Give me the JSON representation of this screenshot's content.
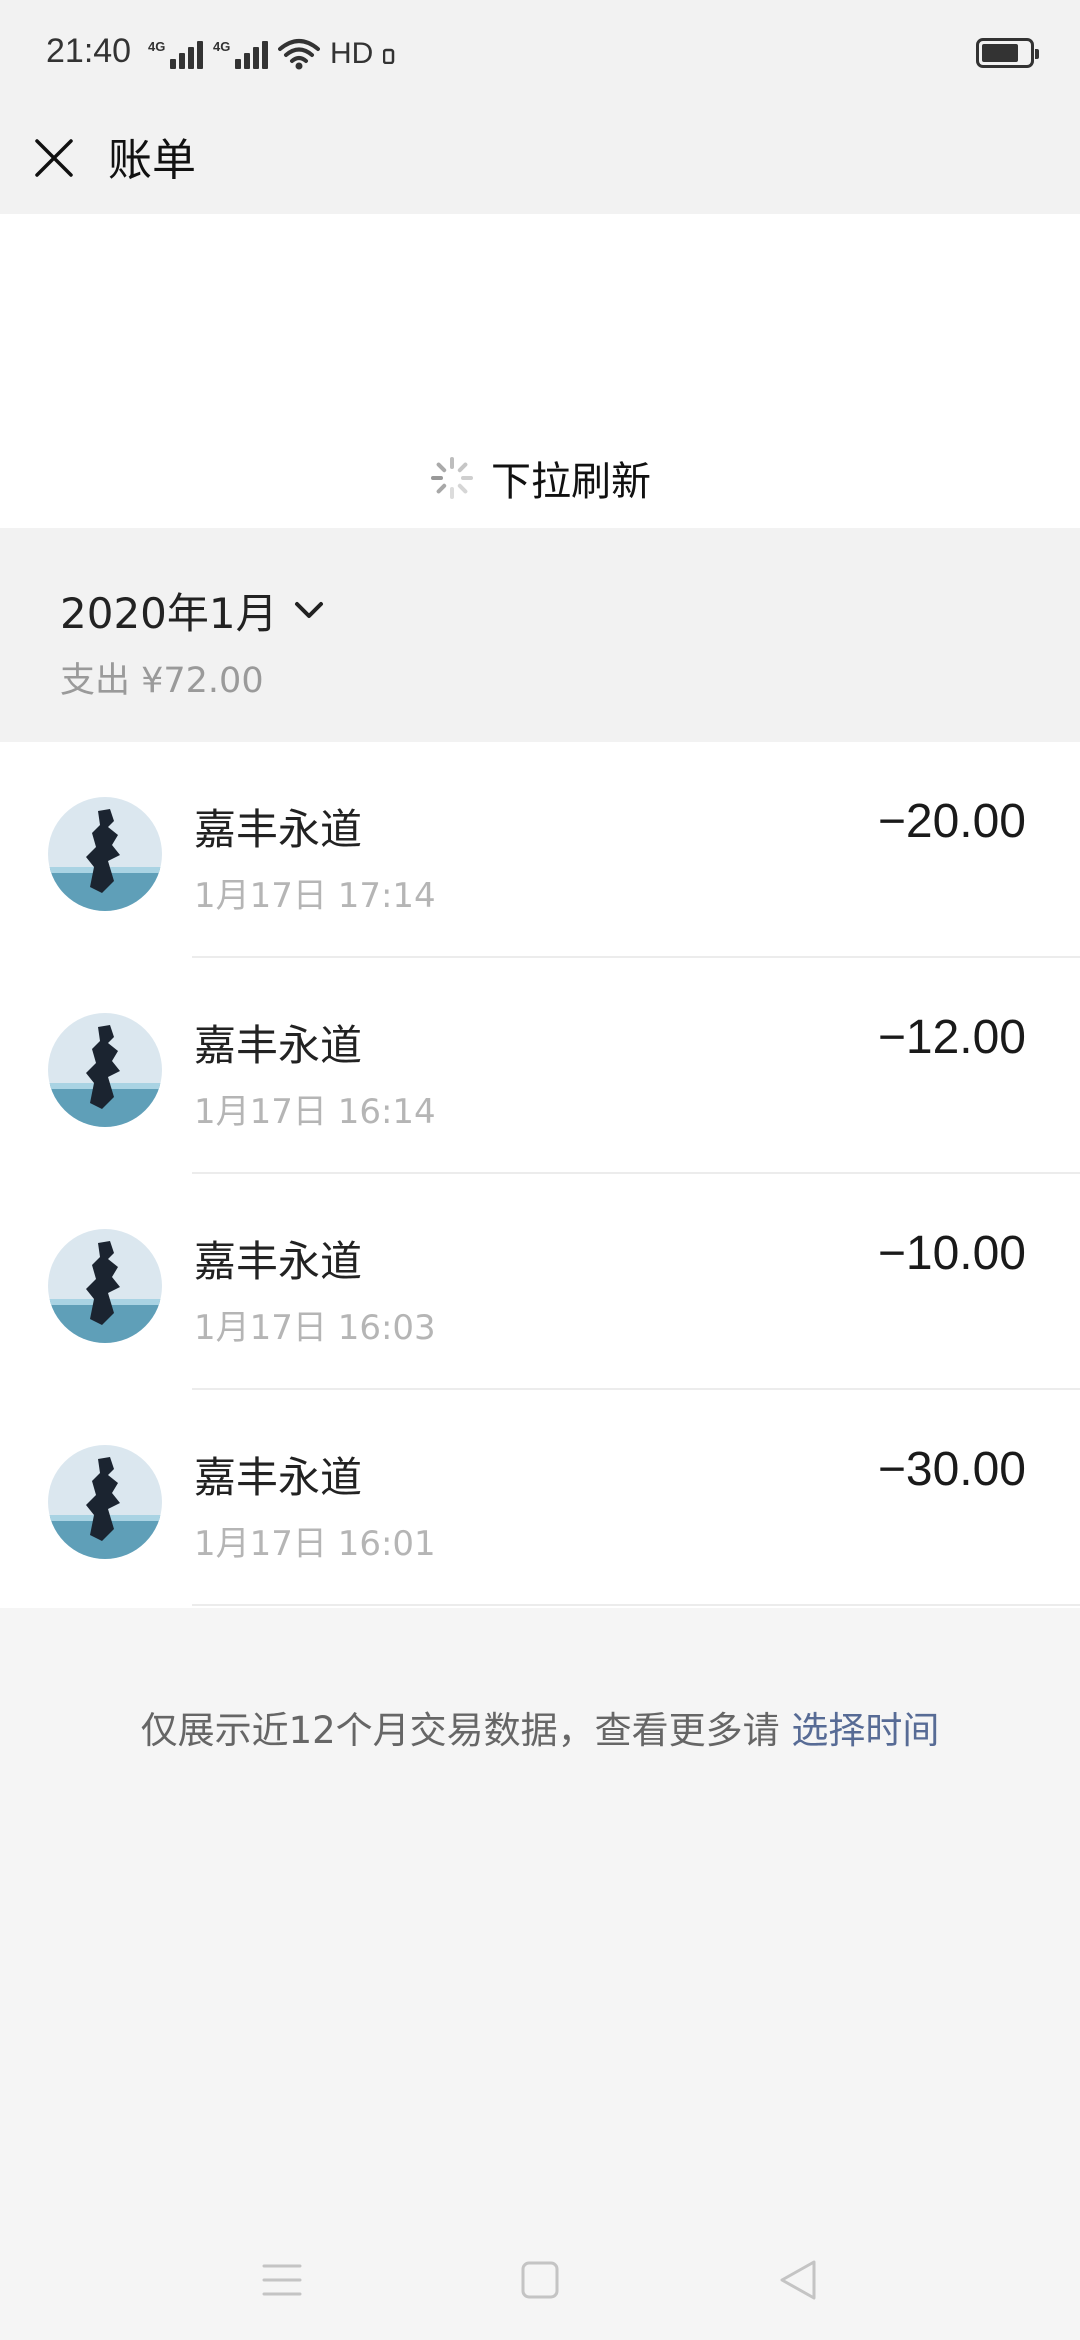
{
  "status_bar": {
    "time": "21:40",
    "network_1": "4G",
    "network_2": "4G",
    "hd": "HD",
    "icons": [
      "signal-icon",
      "signal-icon",
      "wifi-icon",
      "battery-icon"
    ]
  },
  "header": {
    "title": "账单",
    "close_icon": "close-icon"
  },
  "refresh": {
    "label": "下拉刷新",
    "icon": "spinner-icon"
  },
  "month": {
    "label": "2020年1月",
    "expense": "支出 ¥72.00",
    "icon": "chevron-down-icon"
  },
  "transactions": [
    {
      "merchant": "嘉丰永道",
      "time": "1月17日 17:14",
      "amount": "−20.00"
    },
    {
      "merchant": "嘉丰永道",
      "time": "1月17日 16:14",
      "amount": "−12.00"
    },
    {
      "merchant": "嘉丰永道",
      "time": "1月17日 16:03",
      "amount": "−10.00"
    },
    {
      "merchant": "嘉丰永道",
      "time": "1月17日 16:01",
      "amount": "−30.00"
    }
  ],
  "footer": {
    "note": "仅展示近12个月交易数据，查看更多请 ",
    "link": "选择时间"
  },
  "nav": {
    "icons": [
      "menu-icon",
      "home-icon",
      "back-icon"
    ]
  },
  "colors": {
    "link": "#576b95",
    "background": "#f5f5f5",
    "card": "#ffffff"
  }
}
